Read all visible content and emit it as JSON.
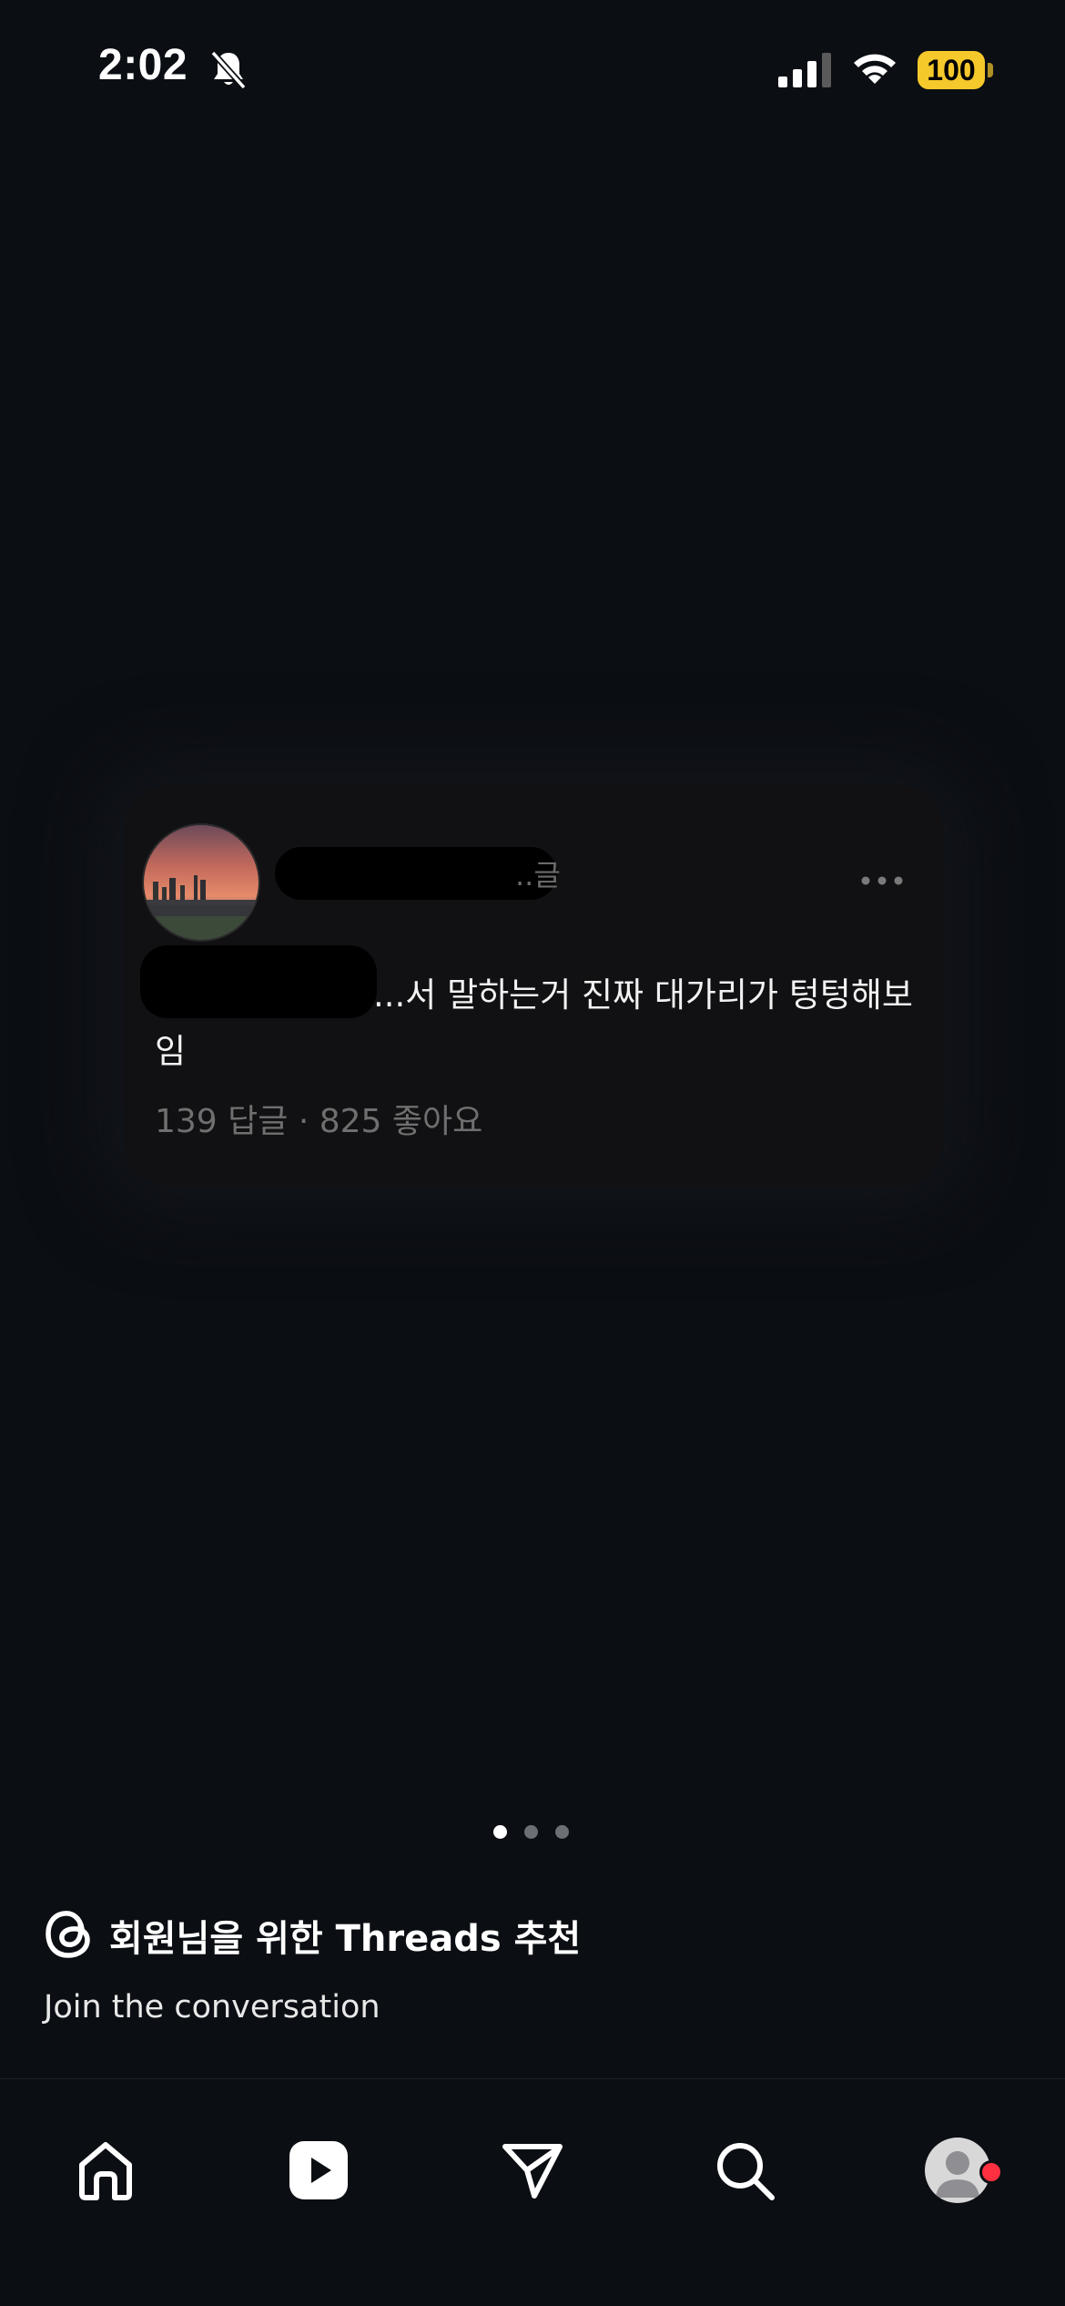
{
  "status_bar": {
    "time": "2:02",
    "battery": "100",
    "icons": [
      "bell-slash-icon",
      "cellular-signal-icon",
      "wifi-icon",
      "battery-icon"
    ],
    "battery_color": "#f5c82b"
  },
  "post": {
    "username_visible_suffix": "..글",
    "text_line1": "...서 말하는거 진짜 대가리가 텅텅해보",
    "text_line2": "임",
    "stats": "139 답글 · 825 좋아요"
  },
  "pager": {
    "total": 3,
    "active_index": 0
  },
  "threads_section": {
    "title": "회원님을 위한 Threads 추천",
    "subtitle": "Join the conversation"
  },
  "tab_bar": {
    "items": [
      {
        "icon": "home-icon"
      },
      {
        "icon": "reels-icon"
      },
      {
        "icon": "direct-message-icon"
      },
      {
        "icon": "search-icon"
      },
      {
        "icon": "profile-icon"
      }
    ],
    "notification_color": "#ff3040"
  }
}
